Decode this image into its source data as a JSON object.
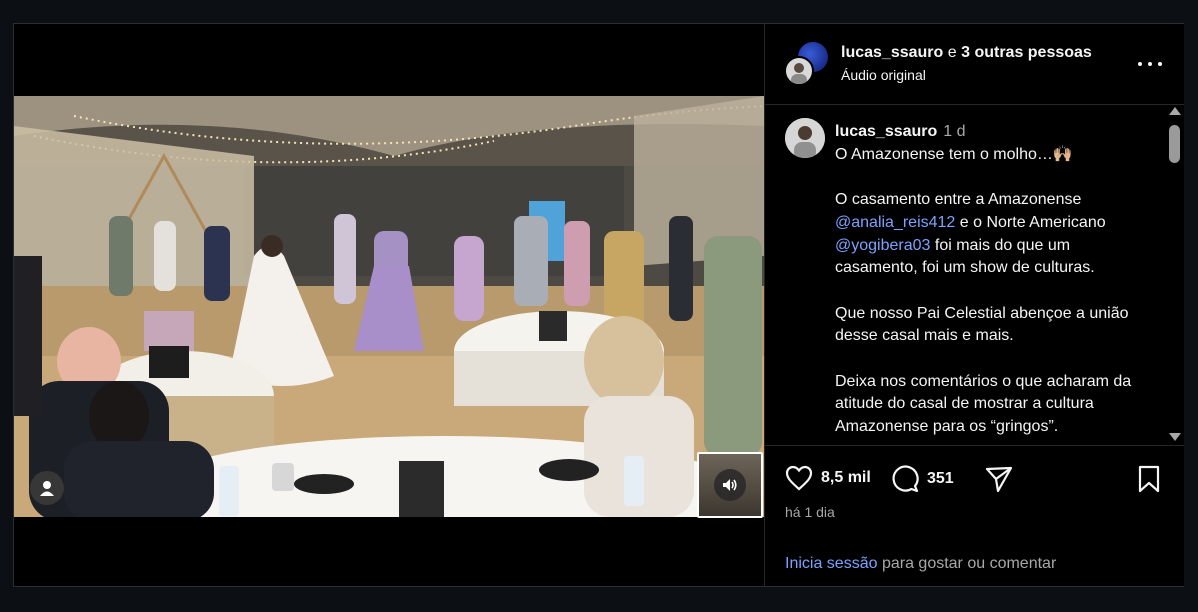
{
  "post": {
    "header": {
      "username": "lucas_ssauro",
      "connector": "e",
      "others": "3 outras pessoas",
      "audio": "Áudio original"
    },
    "caption": {
      "username": "lucas_ssauro",
      "time": "1 d",
      "line1": "O Amazonense tem o molho…🙌🏼",
      "p2_a": "O casamento entre a Amazonense ",
      "mention1": "@analia_reis412",
      "p2_b": " e o Norte Americano ",
      "mention2": "@yogibera03",
      "p2_c": " foi mais do que um casamento, foi um show de culturas.",
      "p3": "Que nosso Pai Celestial abençoe a união desse casal mais e mais.",
      "p4": "Deixa nos comentários o que acharam da atitude do casal de mostrar a cultura Amazonense para os “gringos”."
    },
    "actions": {
      "likes": "8,5 mil",
      "comments": "351"
    },
    "date": "há 1 dia",
    "login": {
      "link": "Inicia sessão",
      "rest": " para gostar ou comentar"
    }
  },
  "icons": {
    "like": "heart-icon",
    "comment": "comment-bubble-icon",
    "share": "paper-plane-icon",
    "save": "bookmark-icon",
    "more": "more-dots-icon",
    "mute": "speaker-icon",
    "tag": "user-tag-icon"
  },
  "colors": {
    "background": "#0c1014",
    "panel": "#000000",
    "link": "#7aa2ff",
    "muted": "#a8a8a8"
  }
}
